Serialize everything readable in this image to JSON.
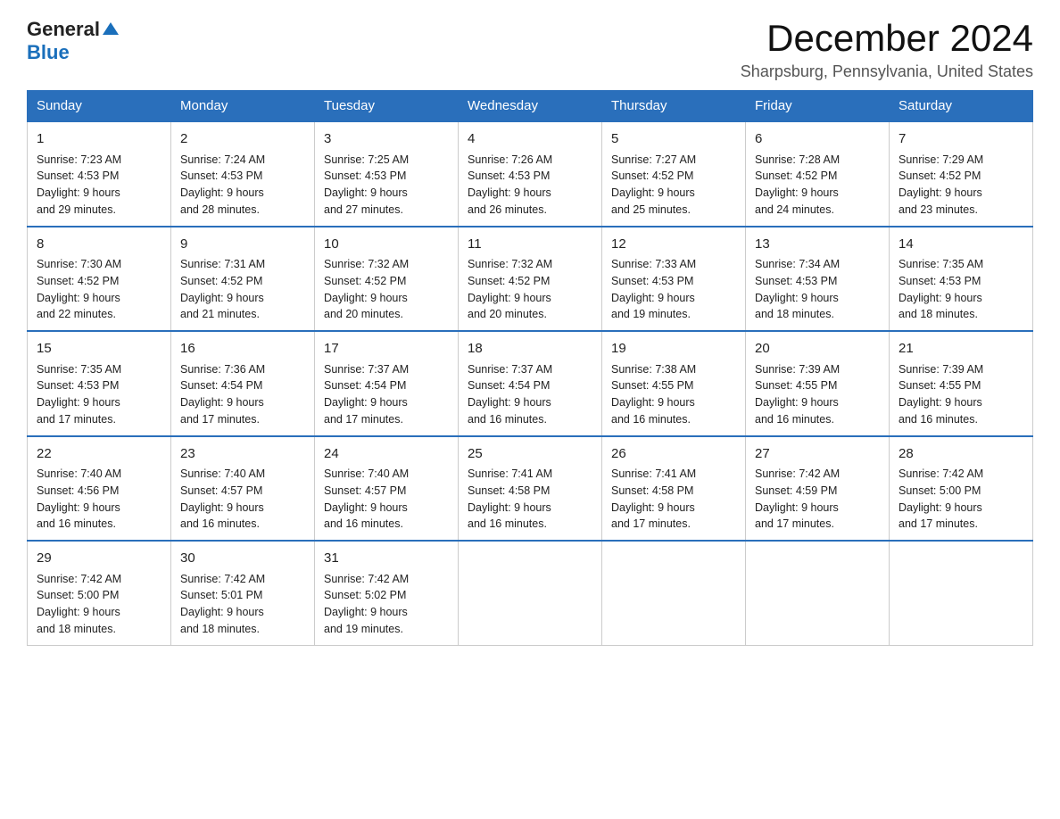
{
  "header": {
    "logo_general": "General",
    "logo_blue": "Blue",
    "main_title": "December 2024",
    "subtitle": "Sharpsburg, Pennsylvania, United States"
  },
  "calendar": {
    "days_of_week": [
      "Sunday",
      "Monday",
      "Tuesday",
      "Wednesday",
      "Thursday",
      "Friday",
      "Saturday"
    ],
    "weeks": [
      [
        {
          "day": "1",
          "sunrise": "7:23 AM",
          "sunset": "4:53 PM",
          "daylight": "9 hours and 29 minutes."
        },
        {
          "day": "2",
          "sunrise": "7:24 AM",
          "sunset": "4:53 PM",
          "daylight": "9 hours and 28 minutes."
        },
        {
          "day": "3",
          "sunrise": "7:25 AM",
          "sunset": "4:53 PM",
          "daylight": "9 hours and 27 minutes."
        },
        {
          "day": "4",
          "sunrise": "7:26 AM",
          "sunset": "4:53 PM",
          "daylight": "9 hours and 26 minutes."
        },
        {
          "day": "5",
          "sunrise": "7:27 AM",
          "sunset": "4:52 PM",
          "daylight": "9 hours and 25 minutes."
        },
        {
          "day": "6",
          "sunrise": "7:28 AM",
          "sunset": "4:52 PM",
          "daylight": "9 hours and 24 minutes."
        },
        {
          "day": "7",
          "sunrise": "7:29 AM",
          "sunset": "4:52 PM",
          "daylight": "9 hours and 23 minutes."
        }
      ],
      [
        {
          "day": "8",
          "sunrise": "7:30 AM",
          "sunset": "4:52 PM",
          "daylight": "9 hours and 22 minutes."
        },
        {
          "day": "9",
          "sunrise": "7:31 AM",
          "sunset": "4:52 PM",
          "daylight": "9 hours and 21 minutes."
        },
        {
          "day": "10",
          "sunrise": "7:32 AM",
          "sunset": "4:52 PM",
          "daylight": "9 hours and 20 minutes."
        },
        {
          "day": "11",
          "sunrise": "7:32 AM",
          "sunset": "4:52 PM",
          "daylight": "9 hours and 20 minutes."
        },
        {
          "day": "12",
          "sunrise": "7:33 AM",
          "sunset": "4:53 PM",
          "daylight": "9 hours and 19 minutes."
        },
        {
          "day": "13",
          "sunrise": "7:34 AM",
          "sunset": "4:53 PM",
          "daylight": "9 hours and 18 minutes."
        },
        {
          "day": "14",
          "sunrise": "7:35 AM",
          "sunset": "4:53 PM",
          "daylight": "9 hours and 18 minutes."
        }
      ],
      [
        {
          "day": "15",
          "sunrise": "7:35 AM",
          "sunset": "4:53 PM",
          "daylight": "9 hours and 17 minutes."
        },
        {
          "day": "16",
          "sunrise": "7:36 AM",
          "sunset": "4:54 PM",
          "daylight": "9 hours and 17 minutes."
        },
        {
          "day": "17",
          "sunrise": "7:37 AM",
          "sunset": "4:54 PM",
          "daylight": "9 hours and 17 minutes."
        },
        {
          "day": "18",
          "sunrise": "7:37 AM",
          "sunset": "4:54 PM",
          "daylight": "9 hours and 16 minutes."
        },
        {
          "day": "19",
          "sunrise": "7:38 AM",
          "sunset": "4:55 PM",
          "daylight": "9 hours and 16 minutes."
        },
        {
          "day": "20",
          "sunrise": "7:39 AM",
          "sunset": "4:55 PM",
          "daylight": "9 hours and 16 minutes."
        },
        {
          "day": "21",
          "sunrise": "7:39 AM",
          "sunset": "4:55 PM",
          "daylight": "9 hours and 16 minutes."
        }
      ],
      [
        {
          "day": "22",
          "sunrise": "7:40 AM",
          "sunset": "4:56 PM",
          "daylight": "9 hours and 16 minutes."
        },
        {
          "day": "23",
          "sunrise": "7:40 AM",
          "sunset": "4:57 PM",
          "daylight": "9 hours and 16 minutes."
        },
        {
          "day": "24",
          "sunrise": "7:40 AM",
          "sunset": "4:57 PM",
          "daylight": "9 hours and 16 minutes."
        },
        {
          "day": "25",
          "sunrise": "7:41 AM",
          "sunset": "4:58 PM",
          "daylight": "9 hours and 16 minutes."
        },
        {
          "day": "26",
          "sunrise": "7:41 AM",
          "sunset": "4:58 PM",
          "daylight": "9 hours and 17 minutes."
        },
        {
          "day": "27",
          "sunrise": "7:42 AM",
          "sunset": "4:59 PM",
          "daylight": "9 hours and 17 minutes."
        },
        {
          "day": "28",
          "sunrise": "7:42 AM",
          "sunset": "5:00 PM",
          "daylight": "9 hours and 17 minutes."
        }
      ],
      [
        {
          "day": "29",
          "sunrise": "7:42 AM",
          "sunset": "5:00 PM",
          "daylight": "9 hours and 18 minutes."
        },
        {
          "day": "30",
          "sunrise": "7:42 AM",
          "sunset": "5:01 PM",
          "daylight": "9 hours and 18 minutes."
        },
        {
          "day": "31",
          "sunrise": "7:42 AM",
          "sunset": "5:02 PM",
          "daylight": "9 hours and 19 minutes."
        },
        null,
        null,
        null,
        null
      ]
    ],
    "labels": {
      "sunrise": "Sunrise:",
      "sunset": "Sunset:",
      "daylight": "Daylight:"
    }
  }
}
